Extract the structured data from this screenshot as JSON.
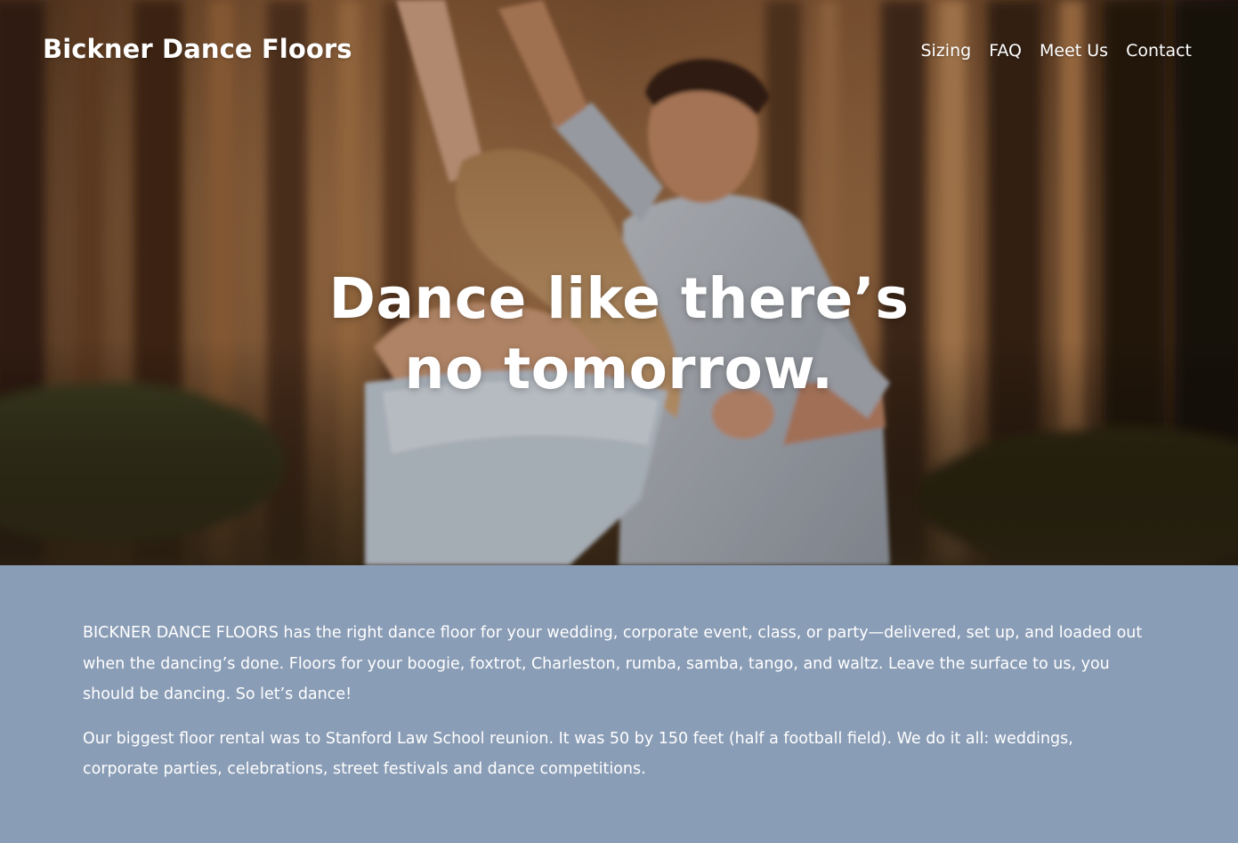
{
  "colors": {
    "intro_background": "#8a9db6",
    "text": "#ffffff"
  },
  "header": {
    "site_title": "Bickner Dance Floors",
    "nav": [
      {
        "label": "Sizing"
      },
      {
        "label": "FAQ"
      },
      {
        "label": "Meet Us"
      },
      {
        "label": "Contact"
      }
    ]
  },
  "hero": {
    "photo": "couple-dancing-in-forest",
    "headline_line1": "Dance like there’s",
    "headline_line2": "no tomorrow."
  },
  "intro": {
    "paragraph1": "BICKNER DANCE FLOORS has the right dance floor for your wedding, corporate event, class, or party—delivered, set up, and loaded out when the dancing’s done. Floors for your boogie, foxtrot, Charleston, rumba, samba, tango, and waltz. Leave the surface to us, you should be dancing. So let’s dance!",
    "paragraph2": "Our biggest floor rental was to Stanford Law School reunion. It was 50 by 150 feet (half a football field). We do it all: weddings, corporate parties, celebrations, street festivals and dance competitions."
  }
}
